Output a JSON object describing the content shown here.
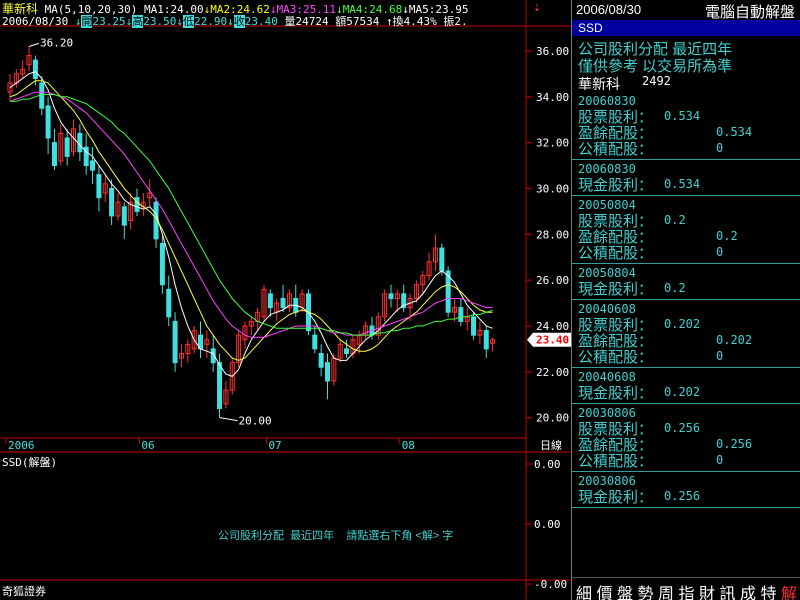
{
  "header": {
    "stock_name": "華新科",
    "ma_label": "MA(5,10,20,30)",
    "ma_items": [
      {
        "text": "MA1:24.00",
        "color": "#ffffff"
      },
      {
        "text": "MA2:24.62",
        "color": "#ffff00"
      },
      {
        "text": "MA3:25.11",
        "color": "#ff40ff"
      },
      {
        "text": "MA4:24.68",
        "color": "#40ff40"
      },
      {
        "text": "MA5:23.95",
        "color": "#ffffff"
      }
    ],
    "date": "2006/08/30",
    "quotes": [
      {
        "label": "開",
        "value": "23.25",
        "arrow": "↓"
      },
      {
        "label": "高",
        "value": "23.50",
        "arrow": "↓"
      },
      {
        "label": "低",
        "value": "22.90",
        "arrow": "↓"
      },
      {
        "label": "收",
        "value": "23.40",
        "arrow": "↓"
      }
    ],
    "volume": "量24724",
    "amount": "額57534",
    "turnover": "換4.43%",
    "amplitude": "振2."
  },
  "colors": {
    "up": "#ff3030",
    "down": "#40e0e0",
    "ma1": "#ffffff",
    "ma2": "#ffff40",
    "ma3": "#ff40ff",
    "ma4": "#40ff40",
    "axis": "#cc0000",
    "label": "#40d0d0"
  },
  "chart_data": {
    "type": "candlestick",
    "y_ticks": [
      "36.00",
      "34.00",
      "32.00",
      "30.00",
      "28.00",
      "26.00",
      "24.00",
      "22.00",
      "20.00"
    ],
    "ylim": [
      19.2,
      37.0
    ],
    "x_ticks": [
      "2006",
      "06",
      "07",
      "08"
    ],
    "x_unit": "日線",
    "max_label": "36.20",
    "min_label": "20.00",
    "last_price": "23.40",
    "candles": [
      [
        34.2,
        35.0,
        33.8,
        34.6
      ],
      [
        34.6,
        35.2,
        34.4,
        35.0
      ],
      [
        35.0,
        35.6,
        34.8,
        35.2
      ],
      [
        35.4,
        36.2,
        35.1,
        35.8
      ],
      [
        35.6,
        35.8,
        34.5,
        34.8
      ],
      [
        34.6,
        34.9,
        33.2,
        33.5
      ],
      [
        33.6,
        34.0,
        31.5,
        32.2
      ],
      [
        32.0,
        32.6,
        30.8,
        31.0
      ],
      [
        31.2,
        32.8,
        31.0,
        32.4
      ],
      [
        32.2,
        32.6,
        31.0,
        31.4
      ],
      [
        31.6,
        33.0,
        31.4,
        32.6
      ],
      [
        32.4,
        32.8,
        31.2,
        31.6
      ],
      [
        31.8,
        32.4,
        30.6,
        31.0
      ],
      [
        31.2,
        31.8,
        30.2,
        30.8
      ],
      [
        30.6,
        31.0,
        29.0,
        29.6
      ],
      [
        29.8,
        30.6,
        29.4,
        30.2
      ],
      [
        30.0,
        30.4,
        28.4,
        28.8
      ],
      [
        28.8,
        29.8,
        28.6,
        29.4
      ],
      [
        29.2,
        29.4,
        27.8,
        28.4
      ],
      [
        28.6,
        29.8,
        28.2,
        29.4
      ],
      [
        29.6,
        30.0,
        28.8,
        29.0
      ],
      [
        29.2,
        29.8,
        28.8,
        29.4
      ],
      [
        29.6,
        30.4,
        29.2,
        29.8
      ],
      [
        29.4,
        29.6,
        27.4,
        27.8
      ],
      [
        27.6,
        28.0,
        25.4,
        25.8
      ],
      [
        25.6,
        26.2,
        24.0,
        24.4
      ],
      [
        24.2,
        24.6,
        22.0,
        22.4
      ],
      [
        22.6,
        23.2,
        22.2,
        22.8
      ],
      [
        22.8,
        23.4,
        22.4,
        23.2
      ],
      [
        23.0,
        24.0,
        22.8,
        23.8
      ],
      [
        23.6,
        24.2,
        22.6,
        23.0
      ],
      [
        23.2,
        23.8,
        22.6,
        23.4
      ],
      [
        23.0,
        23.6,
        22.0,
        22.4
      ],
      [
        22.4,
        22.8,
        20.0,
        20.4
      ],
      [
        20.6,
        21.6,
        20.4,
        21.2
      ],
      [
        21.2,
        22.6,
        21.0,
        22.4
      ],
      [
        22.4,
        23.8,
        22.2,
        23.6
      ],
      [
        23.4,
        24.2,
        23.0,
        24.0
      ],
      [
        24.0,
        24.4,
        23.6,
        24.2
      ],
      [
        24.2,
        24.8,
        23.8,
        24.6
      ],
      [
        24.4,
        25.8,
        24.2,
        25.6
      ],
      [
        25.4,
        25.6,
        24.4,
        24.8
      ],
      [
        24.6,
        25.2,
        24.2,
        25.0
      ],
      [
        25.2,
        25.8,
        24.6,
        24.8
      ],
      [
        24.8,
        25.6,
        24.6,
        25.4
      ],
      [
        25.2,
        25.8,
        24.4,
        24.6
      ],
      [
        24.8,
        25.6,
        24.6,
        25.4
      ],
      [
        25.4,
        25.6,
        23.6,
        23.8
      ],
      [
        23.6,
        24.0,
        22.8,
        23.0
      ],
      [
        22.8,
        23.2,
        21.8,
        22.2
      ],
      [
        22.4,
        22.8,
        20.8,
        21.6
      ],
      [
        21.6,
        22.8,
        21.4,
        22.6
      ],
      [
        22.6,
        23.4,
        22.4,
        23.2
      ],
      [
        23.0,
        23.4,
        22.6,
        22.8
      ],
      [
        22.8,
        23.6,
        22.6,
        23.4
      ],
      [
        23.2,
        23.8,
        22.8,
        23.6
      ],
      [
        23.6,
        24.2,
        23.4,
        24.0
      ],
      [
        24.0,
        24.4,
        23.4,
        23.6
      ],
      [
        23.6,
        24.6,
        23.4,
        24.4
      ],
      [
        24.4,
        25.6,
        24.2,
        25.4
      ],
      [
        25.4,
        25.8,
        24.8,
        25.2
      ],
      [
        25.2,
        25.6,
        24.6,
        25.4
      ],
      [
        25.4,
        25.8,
        24.6,
        24.8
      ],
      [
        24.8,
        25.4,
        24.2,
        25.2
      ],
      [
        25.2,
        26.0,
        25.0,
        25.8
      ],
      [
        25.8,
        26.4,
        25.4,
        26.2
      ],
      [
        26.2,
        27.2,
        26.0,
        26.8
      ],
      [
        26.8,
        28.0,
        26.4,
        27.4
      ],
      [
        27.4,
        27.6,
        26.2,
        26.4
      ],
      [
        26.4,
        26.6,
        24.4,
        24.6
      ],
      [
        24.6,
        25.2,
        24.2,
        24.8
      ],
      [
        24.8,
        25.2,
        24.0,
        24.2
      ],
      [
        24.2,
        24.8,
        23.8,
        24.4
      ],
      [
        24.4,
        24.6,
        23.4,
        23.6
      ],
      [
        23.6,
        24.2,
        23.2,
        23.8
      ],
      [
        23.8,
        24.0,
        22.6,
        23.0
      ],
      [
        23.25,
        23.5,
        22.9,
        23.4
      ]
    ],
    "ma_series": [
      {
        "key": "ma1",
        "values": [
          34.4,
          34.6,
          34.8,
          35.0,
          35.1,
          34.8,
          34.3,
          33.5,
          32.9,
          32.5,
          32.2,
          31.9,
          31.6,
          31.4,
          31.0,
          30.6,
          30.2,
          29.9,
          29.5,
          29.3,
          29.2,
          29.1,
          29.2,
          28.9,
          28.0,
          27.0,
          25.8,
          24.8,
          24.0,
          23.4,
          23.0,
          22.9,
          22.8,
          22.3,
          21.9,
          21.8,
          22.1,
          22.8,
          23.4,
          23.8,
          24.2,
          24.5,
          24.6,
          24.7,
          24.9,
          24.9,
          24.8,
          24.6,
          24.2,
          23.7,
          23.1,
          22.6,
          22.5,
          22.5,
          22.8,
          23.1,
          23.4,
          23.6,
          23.8,
          24.1,
          24.4,
          24.7,
          24.9,
          25.0,
          25.1,
          25.4,
          25.8,
          26.2,
          26.4,
          26.2,
          25.9,
          25.4,
          24.9,
          24.6,
          24.3,
          24.0,
          23.9
        ]
      },
      {
        "key": "ma2",
        "values": [
          34.0,
          34.1,
          34.3,
          34.5,
          34.7,
          34.7,
          34.6,
          34.3,
          34.0,
          33.7,
          33.4,
          33.0,
          32.5,
          32.1,
          31.6,
          31.2,
          30.8,
          30.4,
          30.0,
          29.7,
          29.4,
          29.2,
          29.0,
          28.7,
          28.2,
          27.6,
          27.0,
          26.4,
          25.8,
          25.2,
          24.6,
          24.0,
          23.6,
          23.2,
          22.9,
          22.6,
          22.5,
          22.6,
          22.9,
          23.2,
          23.5,
          23.8,
          24.1,
          24.3,
          24.5,
          24.6,
          24.7,
          24.6,
          24.5,
          24.3,
          24.0,
          23.7,
          23.4,
          23.2,
          23.0,
          22.9,
          22.9,
          23.0,
          23.2,
          23.5,
          23.8,
          24.0,
          24.2,
          24.4,
          24.6,
          24.9,
          25.2,
          25.5,
          25.7,
          25.8,
          25.7,
          25.5,
          25.2,
          24.9,
          24.7,
          24.6,
          24.6
        ]
      },
      {
        "key": "ma3",
        "values": [
          33.8,
          33.9,
          34.0,
          34.1,
          34.2,
          34.2,
          34.2,
          34.1,
          34.0,
          33.9,
          33.7,
          33.5,
          33.3,
          33.0,
          32.7,
          32.4,
          32.1,
          31.8,
          31.5,
          31.1,
          30.7,
          30.3,
          29.9,
          29.5,
          29.1,
          28.6,
          28.1,
          27.6,
          27.1,
          26.6,
          26.1,
          25.6,
          25.1,
          24.7,
          24.3,
          24.0,
          23.8,
          23.6,
          23.5,
          23.5,
          23.5,
          23.6,
          23.7,
          23.8,
          23.9,
          24.0,
          24.0,
          24.0,
          24.0,
          23.9,
          23.8,
          23.7,
          23.7,
          23.6,
          23.6,
          23.6,
          23.7,
          23.8,
          23.9,
          24.0,
          24.1,
          24.2,
          24.3,
          24.4,
          24.5,
          24.6,
          24.8,
          25.0,
          25.1,
          25.2,
          25.2,
          25.2,
          25.1,
          25.0,
          24.9,
          24.8,
          24.8
        ]
      },
      {
        "key": "ma4",
        "values": [
          33.8,
          33.8,
          33.9,
          33.9,
          34.0,
          34.1,
          34.1,
          34.1,
          34.0,
          34.0,
          33.9,
          33.8,
          33.7,
          33.5,
          33.3,
          33.1,
          32.9,
          32.6,
          32.4,
          32.1,
          31.8,
          31.5,
          31.2,
          30.8,
          30.4,
          30.0,
          29.5,
          29.0,
          28.5,
          28.0,
          27.5,
          27.0,
          26.5,
          26.0,
          25.6,
          25.2,
          24.9,
          24.6,
          24.4,
          24.2,
          24.1,
          24.0,
          23.9,
          23.9,
          23.9,
          23.9,
          23.9,
          23.9,
          23.9,
          23.9,
          23.8,
          23.8,
          23.7,
          23.7,
          23.6,
          23.6,
          23.6,
          23.6,
          23.7,
          23.7,
          23.8,
          23.8,
          23.9,
          23.9,
          24.0,
          24.0,
          24.1,
          24.2,
          24.2,
          24.3,
          24.3,
          24.4,
          24.4,
          24.5,
          24.5,
          24.6,
          24.68
        ]
      }
    ]
  },
  "indicator": {
    "label": "SSD(解盤)",
    "y_ticks": [
      "0.00",
      "0.00",
      "-0.00"
    ],
    "note": "公司股利分配  最近四年    請點選右下角 <解> 字"
  },
  "footer": {
    "broker": "奇狐證券"
  },
  "sidebar": {
    "date": "2006/08/30",
    "caption": "電腦自動解盤",
    "ssd": "SSD",
    "title1": "公司股利分配  最近四年",
    "title2": "僅供參考  以交易所為準",
    "stock_name": "華新科",
    "stock_code": "2492",
    "entries": [
      {
        "date": "20060830",
        "rows": [
          [
            "股票股利：",
            "0.534",
            ""
          ],
          [
            "盈餘配股：",
            "",
            "0.534"
          ],
          [
            "公積配股：",
            "",
            "0"
          ]
        ]
      },
      {
        "date": "20060830",
        "rows": [
          [
            "現金股利：",
            "0.534",
            ""
          ]
        ]
      },
      {
        "date": "20050804",
        "rows": [
          [
            "股票股利：",
            "0.2",
            ""
          ],
          [
            "盈餘配股：",
            "",
            "0.2"
          ],
          [
            "公積配股：",
            "",
            "0"
          ]
        ]
      },
      {
        "date": "20050804",
        "rows": [
          [
            "現金股利：",
            "0.2",
            ""
          ]
        ]
      },
      {
        "date": "20040608",
        "rows": [
          [
            "股票股利：",
            "0.202",
            ""
          ],
          [
            "盈餘配股：",
            "",
            "0.202"
          ],
          [
            "公積配股：",
            "",
            "0"
          ]
        ]
      },
      {
        "date": "20040608",
        "rows": [
          [
            "現金股利：",
            "0.202",
            ""
          ]
        ]
      },
      {
        "date": "20030806",
        "rows": [
          [
            "股票股利：",
            "0.256",
            ""
          ],
          [
            "盈餘配股：",
            "",
            "0.256"
          ],
          [
            "公積配股：",
            "",
            "0"
          ]
        ]
      },
      {
        "date": "20030806",
        "rows": [
          [
            "現金股利：",
            "0.256",
            ""
          ]
        ]
      }
    ],
    "tabs": [
      "細",
      "價",
      "盤",
      "勢",
      "周",
      "指",
      "財",
      "訊",
      "成",
      "特",
      "解"
    ],
    "active_tab": "解"
  }
}
